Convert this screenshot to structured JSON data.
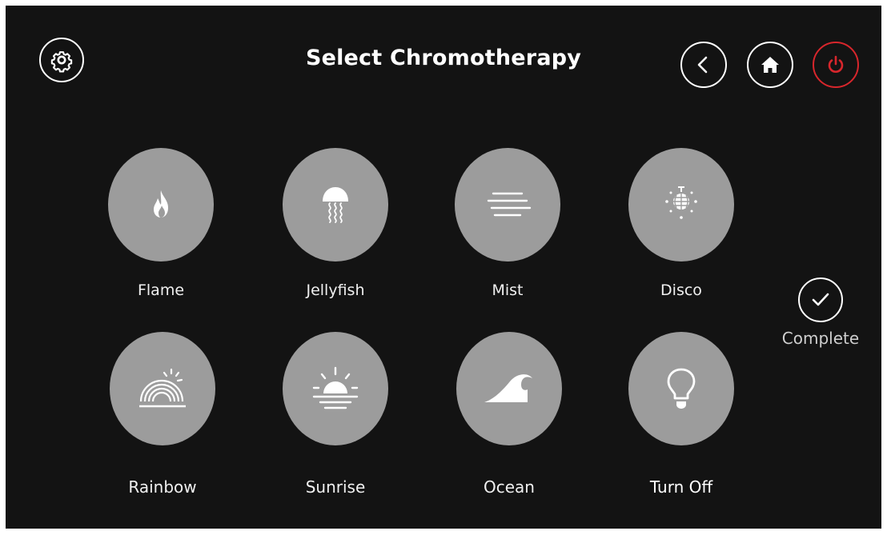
{
  "header": {
    "title": "Select Chromotherapy",
    "settings_icon": "gear-icon",
    "back_icon": "chevron-left-icon",
    "home_icon": "home-icon",
    "power_icon": "power-icon"
  },
  "colors": {
    "background": "#131313",
    "tile": "#9c9c9c",
    "power_accent": "#d8262c",
    "text": "#ffffff"
  },
  "modes": [
    {
      "label": "Flame",
      "icon": "flame-icon"
    },
    {
      "label": "Jellyfish",
      "icon": "jellyfish-icon"
    },
    {
      "label": "Mist",
      "icon": "mist-icon"
    },
    {
      "label": "Disco",
      "icon": "disco-ball-icon"
    },
    {
      "label": "Rainbow",
      "icon": "rainbow-icon"
    },
    {
      "label": "Sunrise",
      "icon": "sunrise-icon"
    },
    {
      "label": "Ocean",
      "icon": "wave-icon"
    },
    {
      "label": "Turn Off",
      "icon": "light-bulb-icon"
    }
  ],
  "complete": {
    "label": "Complete",
    "icon": "check-icon"
  }
}
